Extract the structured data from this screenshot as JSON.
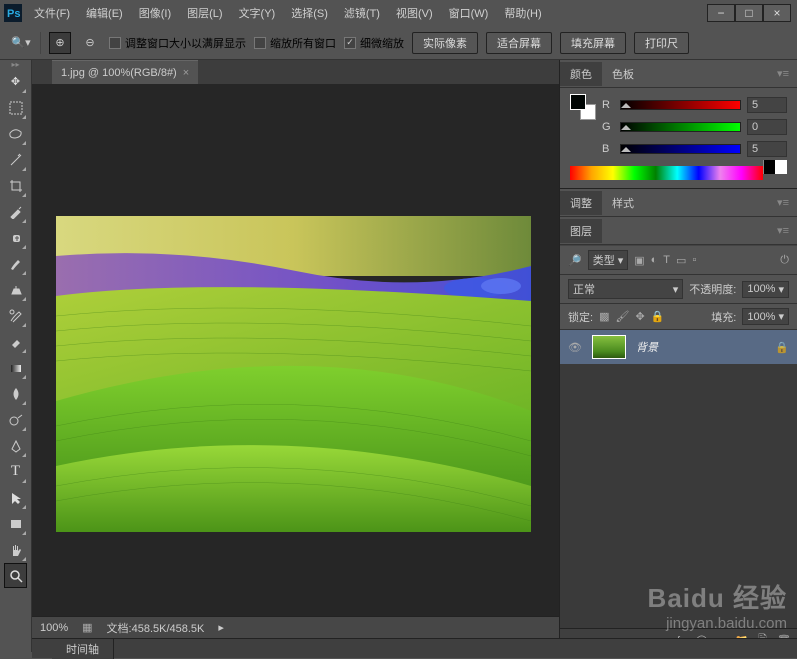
{
  "app": {
    "logo": "Ps"
  },
  "menu": [
    "文件(F)",
    "编辑(E)",
    "图像(I)",
    "图层(L)",
    "文字(Y)",
    "选择(S)",
    "滤镜(T)",
    "视图(V)",
    "窗口(W)",
    "帮助(H)"
  ],
  "options": {
    "fit_screen": "调整窗口大小以满屏显示",
    "zoom_all": "缩放所有窗口",
    "scrubby": "细微缩放",
    "actual": "实际像素",
    "fit": "适合屏幕",
    "fill": "填充屏幕",
    "print": "打印尺"
  },
  "doc_tab": {
    "title": "1.jpg @ 100%(RGB/8#)",
    "close": "×"
  },
  "color": {
    "tab_color": "颜色",
    "tab_swatch": "色板",
    "r_label": "R",
    "r_val": "5",
    "g_label": "G",
    "g_val": "0",
    "b_label": "B",
    "b_val": "5"
  },
  "adjust": {
    "tab_adj": "调整",
    "tab_style": "样式"
  },
  "layers": {
    "tab": "图层",
    "filter": "类型",
    "blend": "正常",
    "opacity_lbl": "不透明度:",
    "opacity_val": "100%",
    "lock_lbl": "锁定:",
    "fill_lbl": "填充:",
    "fill_val": "100%",
    "item_name": "背景"
  },
  "status": {
    "zoom": "100%",
    "docinfo": "文档:458.5K/458.5K"
  },
  "timeline": {
    "tab": "时间轴"
  },
  "watermark": {
    "brand": "Baidu 经验",
    "url": "jingyan.baidu.com"
  }
}
